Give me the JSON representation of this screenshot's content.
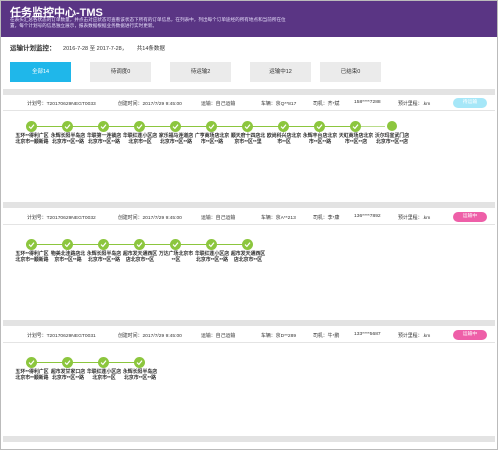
{
  "header": {
    "title": "任务监控中心-TMS",
    "description": "在表头汇总各状态的订单数量，并点击对应状态可查看该状态下所有的订单信息，在列表中，列出每个订单途经的所有地点和当前所在位置，每个计划号的信息独立展示，报表数据根据业务数据进行实时更新。"
  },
  "summary": {
    "label": "运输计划监控：",
    "date_range": "2016-7-28 至 2017-7-28，",
    "total": "共14条数据"
  },
  "tabs": [
    {
      "label": "全部14"
    },
    {
      "label": "待调度0"
    },
    {
      "label": "待运输2"
    },
    {
      "label": "运输中12"
    },
    {
      "label": "已结束0"
    }
  ],
  "colors": {
    "accent": "#1fb7ea",
    "progress": "#8cc63e",
    "header": "#5a3584",
    "pending": "#a6e7f8",
    "transit": "#ee5fa8"
  },
  "orders": [
    {
      "plan_no": "计划号：T20170629NEGT0033",
      "created": "创建时间：2017/7/29 9:45:00",
      "transport": "运输：自己运输",
      "vehicle": "车辆：京Q**817",
      "driver": "司机：齐*斌",
      "phone": "158****7288",
      "mileage": "预计里程：.km",
      "status": "待运输",
      "stops": [
        {
          "label": "五环**得利广区北京市**顺新路"
        },
        {
          "label": "永辉长阳半岛店北京市**区**路"
        },
        {
          "label": "华联第一连锁店北京市**区**路"
        },
        {
          "label": "华联红莲小区店北京市**区"
        },
        {
          "label": "家乐福马连道店北京市**区**路"
        },
        {
          "label": "广亨商场店北京市**区**路"
        },
        {
          "label": "顺天府十四店北京市**区**里"
        },
        {
          "label": "欧尚科兴店北京市**区"
        },
        {
          "label": "永辉丰台店北京市**区**路"
        },
        {
          "label": "天虹商场店北京市**区**店"
        },
        {
          "label": "沃尔玛宣武门店北京市**区**店"
        }
      ]
    },
    {
      "plan_no": "计划号：T20170629NEGT0032",
      "created": "创建时间：2017/7/29 9:45:00",
      "transport": "运输：自己运输",
      "vehicle": "车辆：京A**213",
      "driver": "司机：李*康",
      "phone": "136****7892",
      "mileage": "预计里程：.km",
      "status": "运输中",
      "stops": [
        {
          "label": "五环**得利广区北京市**顺新路"
        },
        {
          "label": "物美北洼路店北京市**区**路"
        },
        {
          "label": "永辉长阳半岛店北京市**区**路"
        },
        {
          "label": "超市发天通西区店北京市**区"
        },
        {
          "label": "万达广场北京市**区"
        },
        {
          "label": "华联红莲小区店北京市**区**路"
        },
        {
          "label": "超市发天通西区店北京市**区"
        }
      ]
    },
    {
      "plan_no": "计划号：T20170629NEGT0031",
      "created": "创建时间：2017/7/29 9:45:00",
      "transport": "运输：自己运输",
      "vehicle": "车辆：京D**289",
      "driver": "司机：牛*鹏",
      "phone": "133****5687",
      "mileage": "预计里程：.km",
      "status": "运输中",
      "stops": [
        {
          "label": "五环**得利广区北京市**顺新路"
        },
        {
          "label": "超市发甘家口店北京市**区**路"
        },
        {
          "label": "华联红莲小区店北京市**区"
        },
        {
          "label": "永辉长阳半岛店北京市**区**路"
        }
      ]
    }
  ]
}
